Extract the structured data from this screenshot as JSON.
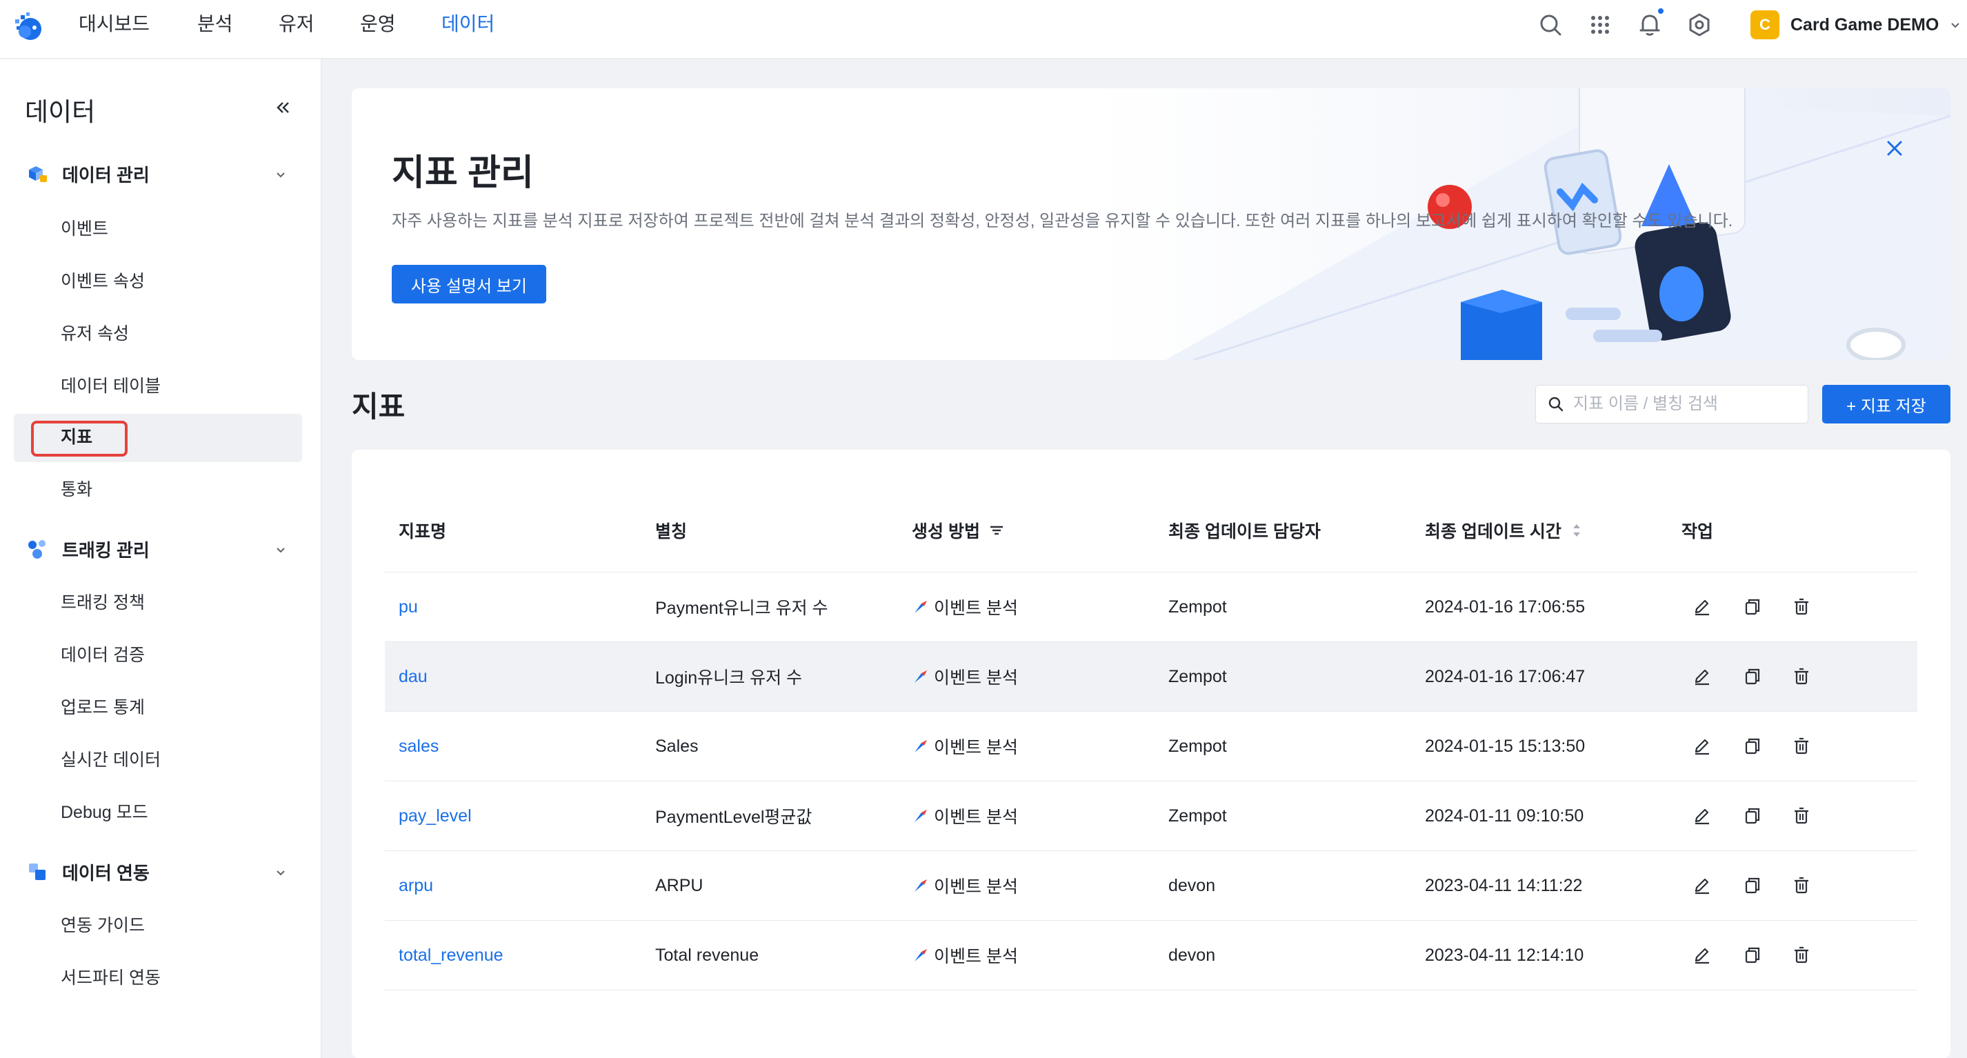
{
  "nav": {
    "items": [
      "대시보드",
      "분석",
      "유저",
      "운영",
      "데이터"
    ],
    "active": "데이터"
  },
  "project": {
    "badge": "C",
    "name": "Card Game DEMO"
  },
  "sidebar": {
    "title": "데이터",
    "groups": [
      {
        "label": "데이터 관리",
        "items": [
          "이벤트",
          "이벤트 속성",
          "유저 속성",
          "데이터 테이블",
          "지표",
          "통화"
        ]
      },
      {
        "label": "트래킹 관리",
        "items": [
          "트래킹 정책",
          "데이터 검증",
          "업로드 통계",
          "실시간 데이터",
          "Debug 모드"
        ]
      },
      {
        "label": "데이터 연동",
        "items": [
          "연동 가이드",
          "서드파티 연동"
        ]
      }
    ],
    "active_item": "지표"
  },
  "banner": {
    "title": "지표 관리",
    "description": "자주 사용하는 지표를 분석 지표로 저장하여 프로젝트 전반에 걸쳐 분석 결과의 정확성, 안정성, 일관성을 유지할 수 있습니다. 또한 여러 지표를 하나의 보고서에 쉽게 표시하여 확인할 수도 있습니다.",
    "button": "사용 설명서 보기"
  },
  "section": {
    "title": "지표",
    "search_placeholder": "지표 이름 / 별칭 검색",
    "add_button": "+ 지표 저장"
  },
  "table": {
    "columns": [
      "지표명",
      "별칭",
      "생성 방법",
      "최종 업데이트 담당자",
      "최종 업데이트 시간",
      "작업"
    ],
    "rows": [
      {
        "name": "pu",
        "alias": "Payment유니크 유저 수",
        "method": "이벤트 분석",
        "updater": "Zempot",
        "time": "2024-01-16 17:06:55"
      },
      {
        "name": "dau",
        "alias": "Login유니크 유저 수",
        "method": "이벤트 분석",
        "updater": "Zempot",
        "time": "2024-01-16 17:06:47"
      },
      {
        "name": "sales",
        "alias": "Sales",
        "method": "이벤트 분석",
        "updater": "Zempot",
        "time": "2024-01-15 15:13:50"
      },
      {
        "name": "pay_level",
        "alias": "PaymentLevel평균값",
        "method": "이벤트 분석",
        "updater": "Zempot",
        "time": "2024-01-11 09:10:50"
      },
      {
        "name": "arpu",
        "alias": "ARPU",
        "method": "이벤트 분석",
        "updater": "devon",
        "time": "2023-04-11 14:11:22"
      },
      {
        "name": "total_revenue",
        "alias": "Total revenue",
        "method": "이벤트 분석",
        "updater": "devon",
        "time": "2023-04-11 12:14:10"
      }
    ]
  },
  "colors": {
    "accent": "#1a6fe8",
    "highlight_box": "#e5413c",
    "project_badge": "#f5b400"
  }
}
